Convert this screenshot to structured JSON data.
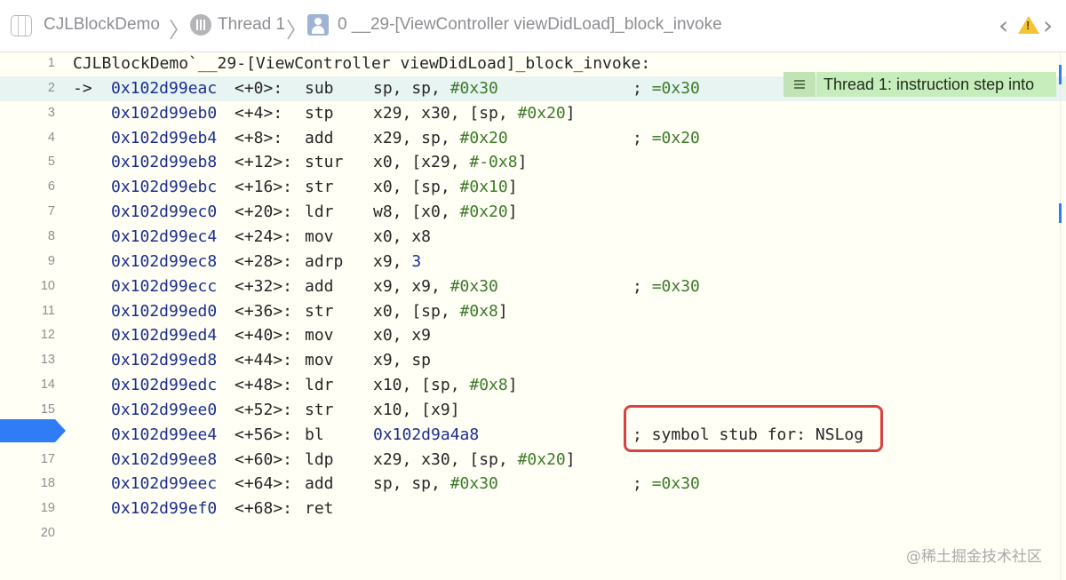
{
  "breadcrumb": {
    "app": "CJLBlockDemo",
    "thread": "Thread 1",
    "frame": "0 __29-[ViewController viewDidLoad]_block_invoke",
    "separator": "〉"
  },
  "nav": {
    "back": "‹",
    "forward": "›",
    "warning_mark": "!"
  },
  "icons": [
    "app-icon",
    "thread-icon",
    "stack-frame-icon",
    "warning-icon",
    "hamburger-icon"
  ],
  "colors": {
    "pc_highlight": "#e8f4f2",
    "annotation": "#c8edbd",
    "breakpoint": "#2f7cf6",
    "callout_border": "#d9423f",
    "address": "#1c2e8c",
    "immediate": "#3d7a2a"
  },
  "disassembly": {
    "header": "CJLBlockDemo`__29-[ViewController viewDidLoad]_block_invoke:",
    "pc_arrow": "->",
    "current_line": 2,
    "breakpoint_line": 16,
    "annotation": "Thread 1: instruction step into",
    "lines": [
      {
        "n": "1"
      },
      {
        "n": "2",
        "addr": "0x102d99eac",
        "off": "<+0>:",
        "mn": "sub",
        "ops": "sp, sp, #0x30",
        "cmt": "; =0x30"
      },
      {
        "n": "3",
        "addr": "0x102d99eb0",
        "off": "<+4>:",
        "mn": "stp",
        "ops": "x29, x30, [sp, #0x20]",
        "cmt": ""
      },
      {
        "n": "4",
        "addr": "0x102d99eb4",
        "off": "<+8>:",
        "mn": "add",
        "ops": "x29, sp, #0x20",
        "cmt": "; =0x20"
      },
      {
        "n": "5",
        "addr": "0x102d99eb8",
        "off": "<+12>:",
        "mn": "stur",
        "ops": "x0, [x29, #-0x8]",
        "cmt": ""
      },
      {
        "n": "6",
        "addr": "0x102d99ebc",
        "off": "<+16>:",
        "mn": "str",
        "ops": "x0, [sp, #0x10]",
        "cmt": ""
      },
      {
        "n": "7",
        "addr": "0x102d99ec0",
        "off": "<+20>:",
        "mn": "ldr",
        "ops": "w8, [x0, #0x20]",
        "cmt": ""
      },
      {
        "n": "8",
        "addr": "0x102d99ec4",
        "off": "<+24>:",
        "mn": "mov",
        "ops": "x0, x8",
        "cmt": ""
      },
      {
        "n": "9",
        "addr": "0x102d99ec8",
        "off": "<+28>:",
        "mn": "adrp",
        "ops": "x9, 3",
        "cmt": ""
      },
      {
        "n": "10",
        "addr": "0x102d99ecc",
        "off": "<+32>:",
        "mn": "add",
        "ops": "x9, x9, #0x30",
        "cmt": "; =0x30"
      },
      {
        "n": "11",
        "addr": "0x102d99ed0",
        "off": "<+36>:",
        "mn": "str",
        "ops": "x0, [sp, #0x8]",
        "cmt": ""
      },
      {
        "n": "12",
        "addr": "0x102d99ed4",
        "off": "<+40>:",
        "mn": "mov",
        "ops": "x0, x9",
        "cmt": ""
      },
      {
        "n": "13",
        "addr": "0x102d99ed8",
        "off": "<+44>:",
        "mn": "mov",
        "ops": "x9, sp",
        "cmt": ""
      },
      {
        "n": "14",
        "addr": "0x102d99edc",
        "off": "<+48>:",
        "mn": "ldr",
        "ops": "x10, [sp, #0x8]",
        "cmt": ""
      },
      {
        "n": "15",
        "addr": "0x102d99ee0",
        "off": "<+52>:",
        "mn": "str",
        "ops": "x10, [x9]",
        "cmt": ""
      },
      {
        "n": "16",
        "addr": "0x102d99ee4",
        "off": "<+56>:",
        "mn": "bl",
        "ops": "0x102d9a4a8",
        "cmt": "; symbol stub for: NSLog"
      },
      {
        "n": "17",
        "addr": "0x102d99ee8",
        "off": "<+60>:",
        "mn": "ldp",
        "ops": "x29, x30, [sp, #0x20]",
        "cmt": ""
      },
      {
        "n": "18",
        "addr": "0x102d99eec",
        "off": "<+64>:",
        "mn": "add",
        "ops": "sp, sp, #0x30",
        "cmt": "; =0x30"
      },
      {
        "n": "19",
        "addr": "0x102d99ef0",
        "off": "<+68>:",
        "mn": "ret",
        "ops": "",
        "cmt": ""
      },
      {
        "n": "20"
      }
    ]
  },
  "watermark": "@稀土掘金技术社区"
}
